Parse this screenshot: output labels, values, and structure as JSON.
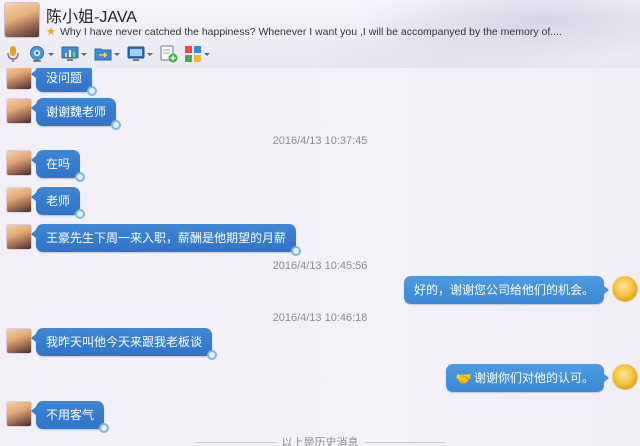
{
  "header": {
    "contact_name": "陈小姐-JAVA",
    "signature": "Why I have never catched the happiness? Whenever I want you ,I will be accompanyed by the memory of....",
    "signature_icon": "star-icon"
  },
  "toolbar": {
    "buttons": [
      {
        "icon": "microphone-icon"
      },
      {
        "icon": "camera-icon",
        "has_menu": true
      },
      {
        "icon": "screen-share-icon",
        "has_menu": true
      },
      {
        "icon": "folder-transfer-icon",
        "has_menu": true
      },
      {
        "icon": "remote-desktop-icon",
        "has_menu": true
      },
      {
        "icon": "add-to-group-icon"
      },
      {
        "icon": "apps-icon",
        "has_menu": true
      }
    ]
  },
  "messages": [
    {
      "side": "left",
      "text": "没问题"
    },
    {
      "side": "left",
      "text": "谢谢魏老师"
    },
    {
      "type": "timestamp",
      "text": "2016/4/13 10:37:45"
    },
    {
      "side": "left",
      "text": "在吗"
    },
    {
      "side": "left",
      "text": "老师"
    },
    {
      "side": "left",
      "text": "王豪先生下周一来入职，薪酬是他期望的月薪"
    },
    {
      "type": "timestamp",
      "text": "2016/4/13 10:45:56"
    },
    {
      "side": "right",
      "text": "好的，谢谢您公司给他们的机会。"
    },
    {
      "type": "timestamp",
      "text": "2016/4/13 10:46:18"
    },
    {
      "side": "left",
      "text": "我昨天叫他今天来跟我老板谈"
    },
    {
      "side": "right",
      "text": "谢谢你们对他的认可。",
      "emoji": "🤝"
    },
    {
      "side": "left",
      "text": "不用客气"
    }
  ],
  "history_note": "以上是历史消息",
  "colors": {
    "bubble_blue": "#3a80d0",
    "background": "#f3eff7",
    "timestamp_gray": "#8c8a94"
  }
}
